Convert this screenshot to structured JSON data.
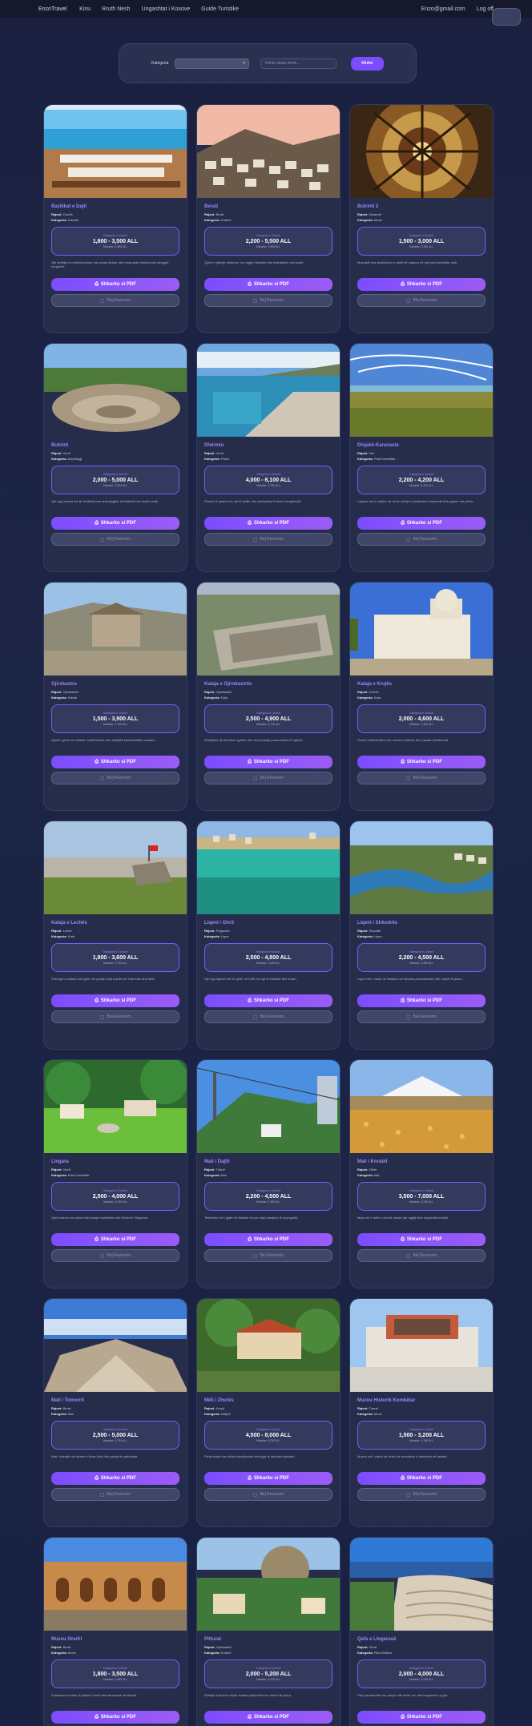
{
  "nav": {
    "brand": "EnzoTravel",
    "links": [
      "Kinu",
      "Rruth Nesh",
      "Ungashtat i Kosove",
      "Guide Turistike"
    ],
    "email": "Enzo@gmail.com",
    "logout": "Log off"
  },
  "filter": {
    "label": "Kategoria",
    "select_value": "",
    "search_placeholder": "Kërko sipas emrit...",
    "button": "Kërko"
  },
  "cards": [
    {
      "title": "Bazilikat e Dajti",
      "region": "Durrës",
      "category": "Historik",
      "price": "1,800 - 3,500 ALL",
      "avg": "Mesatar: 2,650 ALL",
      "desc": "Një shëtitje e mrekullueshme me pamje detare dhe restorante tradicionale përgjatë bregdetit.",
      "photo": "sea-terrace"
    },
    {
      "title": "Berati",
      "region": "Berat",
      "category": "Kulturë",
      "price": "2,200 - 5,500 ALL",
      "avg": "Mesatar: 3,850 ALL",
      "desc": "Qyteti i njëmijë dritareve, me lagjet historike dhe kështjellën mbi kodër.",
      "photo": "old-town"
    },
    {
      "title": "Butrinti 2",
      "region": "Sarandë",
      "category": "Muze",
      "price": "1,500 - 3,000 ALL",
      "avg": "Mesatar: 2,250 ALL",
      "desc": "Mozaikët dhe arkitektura e vjetër të ruajtura në një park kombëtar unik.",
      "photo": "dome"
    },
    {
      "title": "Butrinti",
      "region": "Vlorë",
      "category": "Arkeologji",
      "price": "2,000 - 5,000 ALL",
      "avg": "Mesatar: 3,500 ALL",
      "desc": "Një nga vendet më të rëndësishme arkeologjike të Ballkanit me teatër antik.",
      "photo": "ruins"
    },
    {
      "title": "Dhërmiu",
      "region": "Vlorë",
      "category": "Plazh",
      "price": "4,000 - 6,100 ALL",
      "avg": "Mesatar: 5,050 ALL",
      "desc": "Plazhe të pastra me ujë të kaltër dhe shkëmbinj të bukur bregdetarë.",
      "photo": "coast"
    },
    {
      "title": "Divjakë-Karavasta",
      "region": "Fier",
      "category": "Park Kombëtar",
      "price": "2,200 - 4,200 ALL",
      "avg": "Mesatar: 3,200 ALL",
      "desc": "Laguna më e madhe në vend, shtëpi e pelikanëve kaçurrelë dhe pyjeve me pisha.",
      "photo": "lagoon"
    },
    {
      "title": "Gjirokastra",
      "region": "Gjirokastër",
      "category": "Histori",
      "price": "1,500 - 3,900 ALL",
      "avg": "Mesatar: 2,700 ALL",
      "desc": "Qyteti i gurtë me kalanë madhështore dhe shtëpitë karakteristike osmane.",
      "photo": "stone-house"
    },
    {
      "title": "Kalaja e Gjirokastrës",
      "region": "Gjirokastër",
      "category": "Kala",
      "price": "2,500 - 4,900 ALL",
      "avg": "Mesatar: 3,700 ALL",
      "desc": "Kështjella që dominon qytetin dhe ofron pamje panoramike të luginës.",
      "photo": "castle"
    },
    {
      "title": "Kalaja e Krujës",
      "region": "Durrës",
      "category": "Kala",
      "price": "2,000 - 4,600 ALL",
      "avg": "Mesatar: 3,300 ALL",
      "desc": "Vendi i Skënderbeut me muzeun historik dhe pazarin tradicional.",
      "photo": "white-church"
    },
    {
      "title": "Kalaja e Lezhës",
      "region": "Lezhë",
      "category": "Kala",
      "price": "1,800 - 3,600 ALL",
      "avg": "Mesatar: 2,700 ALL",
      "desc": "Rrënojat e kalasë mbi qytet me pamje drejt fushës së Zadrimës dhe detit.",
      "photo": "fortress-view"
    },
    {
      "title": "Liqeni i Ohrit",
      "region": "Pogradec",
      "category": "Liqen",
      "price": "2,500 - 4,800 ALL",
      "avg": "Mesatar: 3,650 ALL",
      "desc": "Një nga liqenet më të vjetër në botë me ujë të kristaltë dhe koran.",
      "photo": "lake"
    },
    {
      "title": "Liqeni i Shkodrës",
      "region": "Shkodër",
      "category": "Liqen",
      "price": "2,200 - 4,500 ALL",
      "avg": "Mesatar: 3,350 ALL",
      "desc": "Liqeni më i madh në Ballkan me fshatra peshkatarësh dhe natyrë të pasur.",
      "photo": "river"
    },
    {
      "title": "Llogara",
      "region": "Vlorë",
      "category": "Park Kombëtar",
      "price": "2,500 - 4,000 ALL",
      "avg": "Mesatar: 3,250 ALL",
      "desc": "Qafa malore me pisha dhe pamje mahnitëse mbi Rivierën Shqiptare.",
      "photo": "meadow"
    },
    {
      "title": "Mali i Dajtit",
      "region": "Tiranë",
      "category": "Mal",
      "price": "2,200 - 4,500 ALL",
      "avg": "Mesatar: 3,350 ALL",
      "desc": "Teleferiku më i gjatë në Ballkan të çon drejt pamjeve të kryeqytetit.",
      "photo": "cable-car"
    },
    {
      "title": "Mali i Korabit",
      "region": "Dibër",
      "category": "Mal",
      "price": "3,500 - 7,000 ALL",
      "avg": "Mesatar: 5,250 ALL",
      "desc": "Maja më e lartë e vendit, ideale për ngjitje dhe ekspedita malore.",
      "photo": "snow-peak"
    },
    {
      "title": "Mali i Tomorrit",
      "region": "Berat",
      "category": "Mal",
      "price": "2,500 - 5,000 ALL",
      "avg": "Mesatar: 3,750 ALL",
      "desc": "Mali i shenjtë me tyrben e Abaz Aliut dhe pamje të pafundme.",
      "photo": "mountain"
    },
    {
      "title": "Mëli i Zhurës",
      "region": "Korçë",
      "category": "Natyrë",
      "price": "4,500 - 8,000 ALL",
      "avg": "Mesatar: 6,250 ALL",
      "desc": "Fshat malor me shtëpi tradicionale dhe pyje të dendura pishash.",
      "photo": "village"
    },
    {
      "title": "Muzeu Historik Kombëtar",
      "region": "Tiranë",
      "category": "Muze",
      "price": "1,500 - 3,200 ALL",
      "avg": "Mesatar: 2,350 ALL",
      "desc": "Muzeu më i madh në vend me mozaikun e famshëm në fasadë.",
      "photo": "museum"
    },
    {
      "title": "Muzeu Onufri",
      "region": "Berat",
      "category": "Muze",
      "price": "1,800 - 3,500 ALL",
      "avg": "Mesatar: 2,650 ALL",
      "desc": "Koleksion ikonash të piktorit Onufri brenda kalasë së Beratit.",
      "photo": "arcade"
    },
    {
      "title": "Pitturat",
      "region": "Gjirokastër",
      "category": "Kulturë",
      "price": "2,000 - 5,200 ALL",
      "avg": "Mesatar: 3,600 ALL",
      "desc": "Shëtitje kulturore nëpër fshatra piktoreskë me histori të pasur.",
      "photo": "hill-town"
    },
    {
      "title": "Qafa e Llogarasë",
      "region": "Vlorë",
      "category": "Pika Shikimi",
      "price": "2,000 - 4,000 ALL",
      "avg": "Mesatar: 3,000 ALL",
      "desc": "Pika panoramike me pamje mbi detin Jon dhe bregdetin e jugut.",
      "photo": "terraces"
    }
  ],
  "buttons": {
    "pdf": "Shkarko si PDF",
    "reserve": "Bëj Rezervim",
    "price_tag": "Kategoria e Çmimit"
  },
  "labels": {
    "region": "Rajoni:",
    "category": "Kategoria:"
  }
}
